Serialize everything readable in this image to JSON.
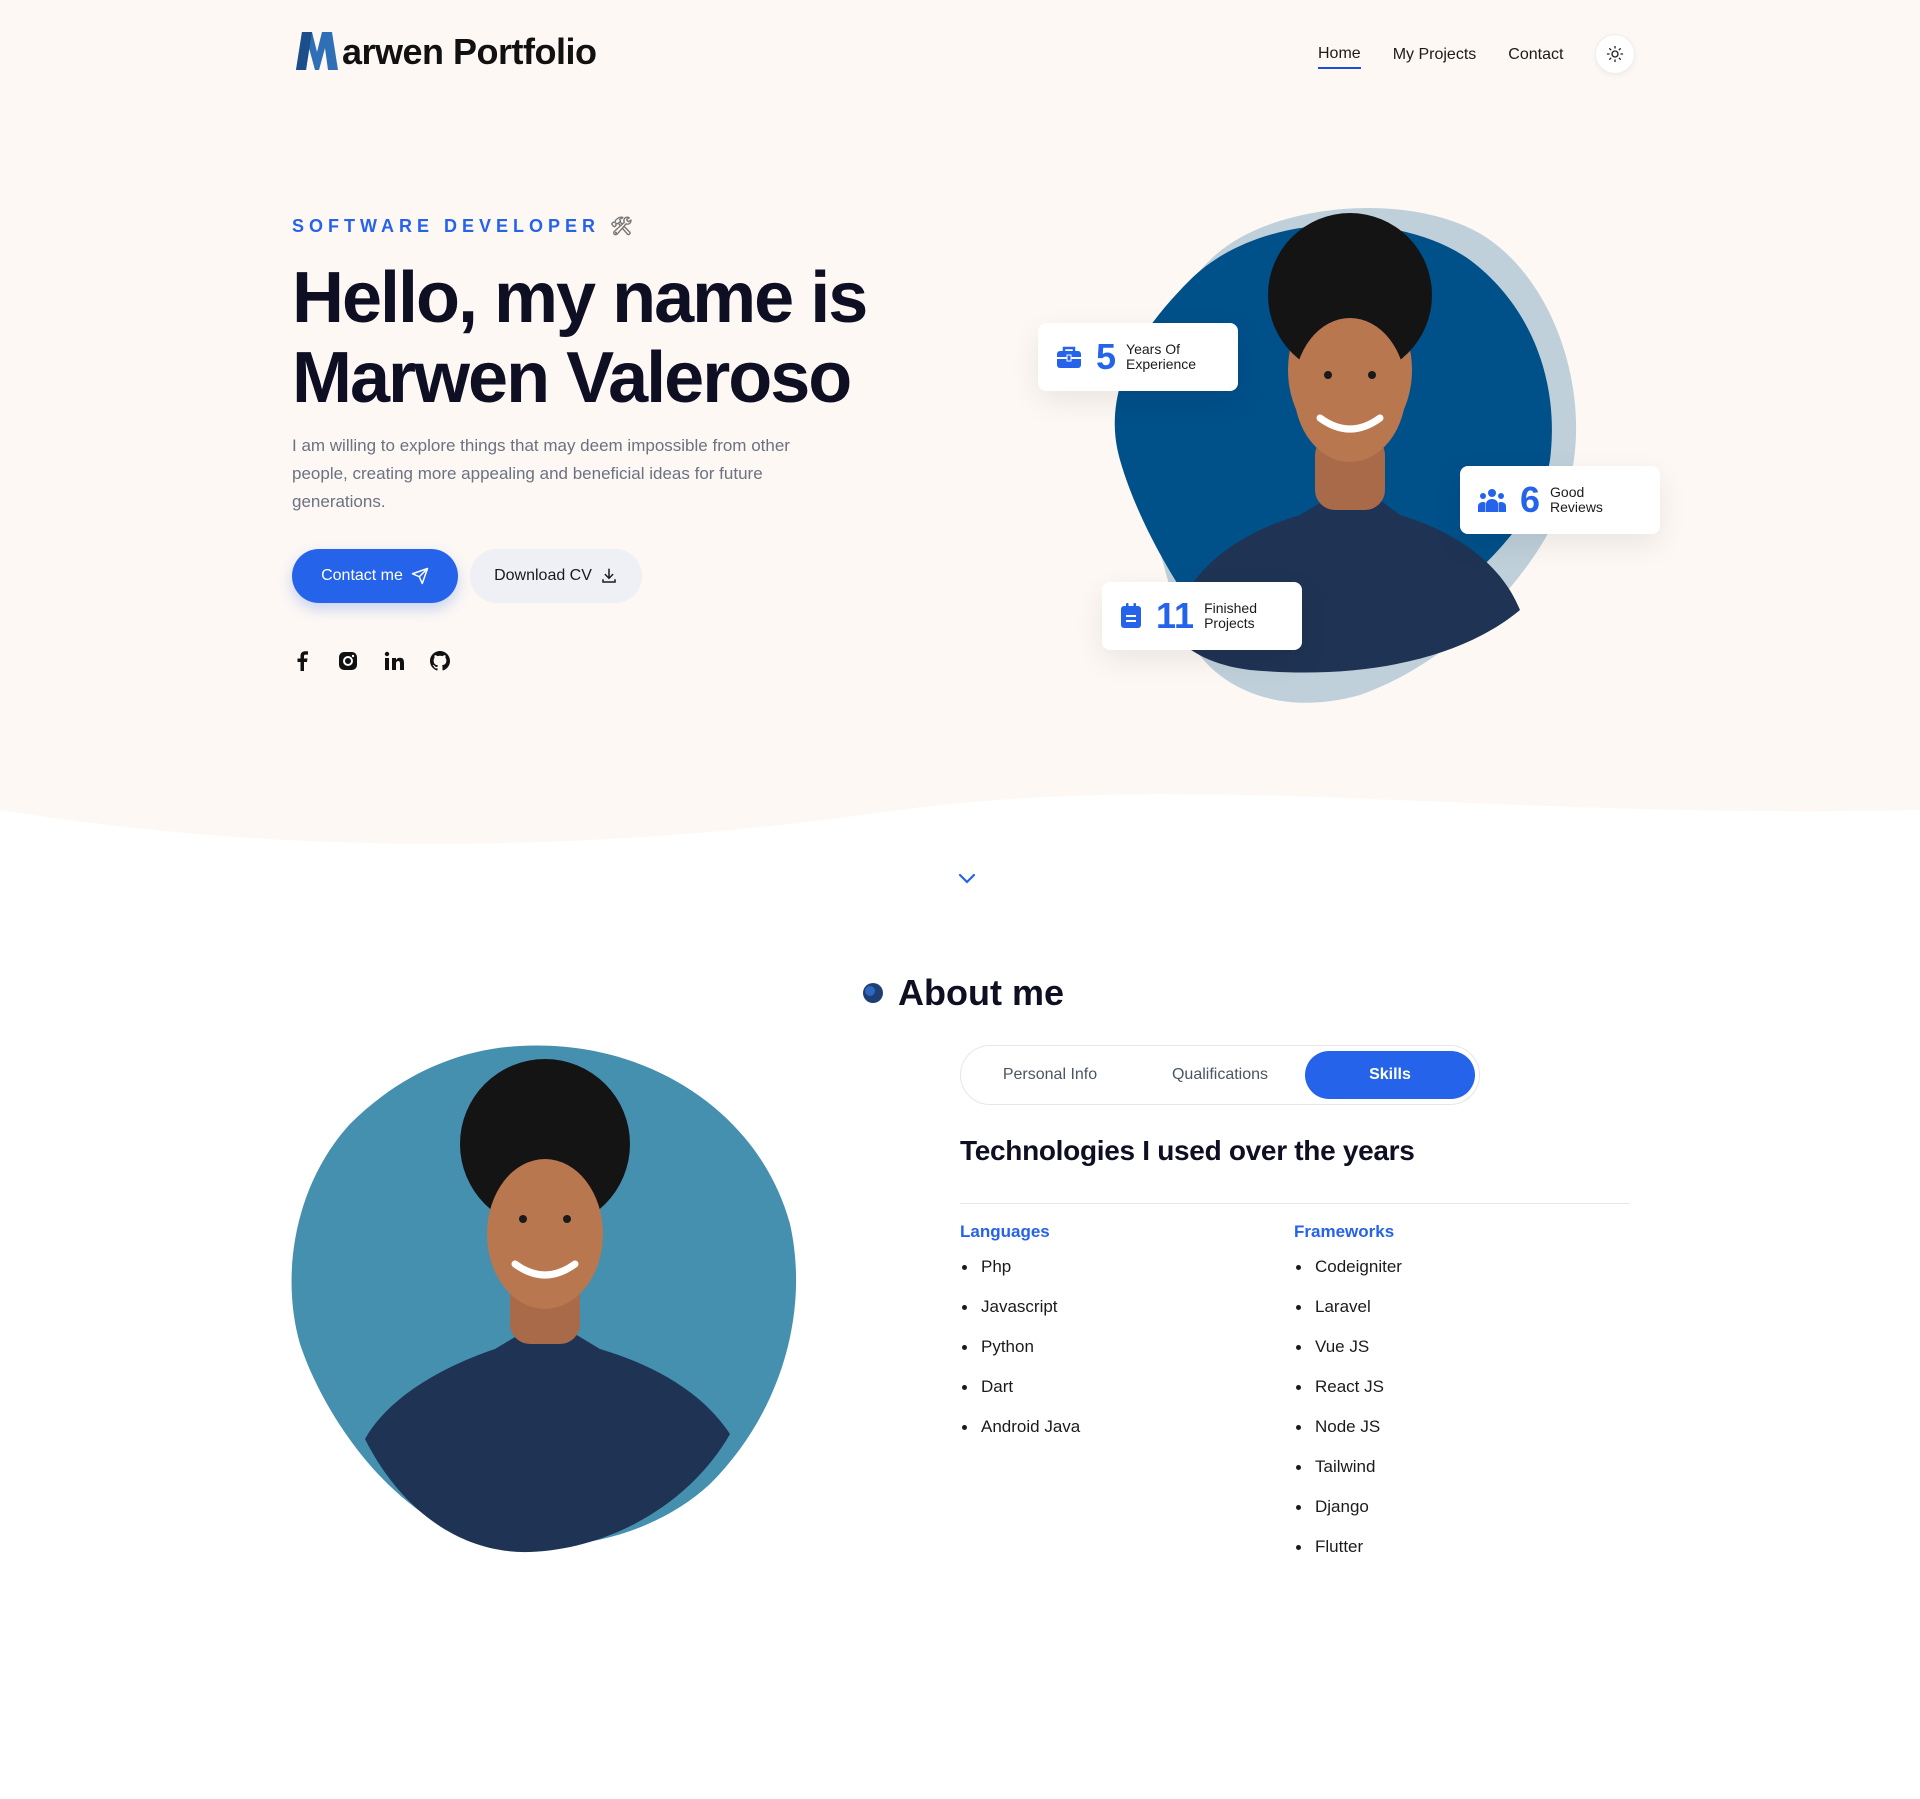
{
  "header": {
    "logo_letter": "M",
    "logo_text": "arwen Portfolio",
    "nav": [
      {
        "label": "Home",
        "active": true
      },
      {
        "label": "My Projects",
        "active": false
      },
      {
        "label": "Contact",
        "active": false
      }
    ],
    "theme_icon": "sun-icon"
  },
  "hero": {
    "role": "SOFTWARE DEVELOPER",
    "role_icon": "🛠",
    "headline_line1": "Hello, my name is",
    "headline_line2": "Marwen Valeroso",
    "intro": "I am willing to explore things that may deem impossible from other people, creating more appealing and beneficial ideas for future generations.",
    "contact_button": "Contact me",
    "download_button": "Download CV",
    "socials": [
      "facebook-icon",
      "instagram-icon",
      "linkedin-icon",
      "github-icon"
    ],
    "stats": [
      {
        "number": "5",
        "line1": "Years Of",
        "line2": "Experience",
        "icon": "briefcase-icon"
      },
      {
        "number": "6",
        "line1": "Good",
        "line2": "Reviews",
        "icon": "users-icon"
      },
      {
        "number": "11",
        "line1": "Finished",
        "line2": "Projects",
        "icon": "clipboard-icon"
      }
    ]
  },
  "about": {
    "title": "About me",
    "tabs": [
      {
        "label": "Personal Info",
        "active": false
      },
      {
        "label": "Qualifications",
        "active": false
      },
      {
        "label": "Skills",
        "active": true
      }
    ],
    "skills_title": "Technologies I used over the years",
    "languages_title": "Languages",
    "languages": [
      "Php",
      "Javascript",
      "Python",
      "Dart",
      "Android Java"
    ],
    "frameworks_title": "Frameworks",
    "frameworks": [
      "Codeigniter",
      "Laravel",
      "Vue JS",
      "React JS",
      "Node JS",
      "Tailwind",
      "Django",
      "Flutter"
    ]
  },
  "colors": {
    "accent": "#2563eb",
    "hero_background": "#fdf8f4",
    "hero_blob": "#00508a",
    "about_blob": "#458faf"
  }
}
